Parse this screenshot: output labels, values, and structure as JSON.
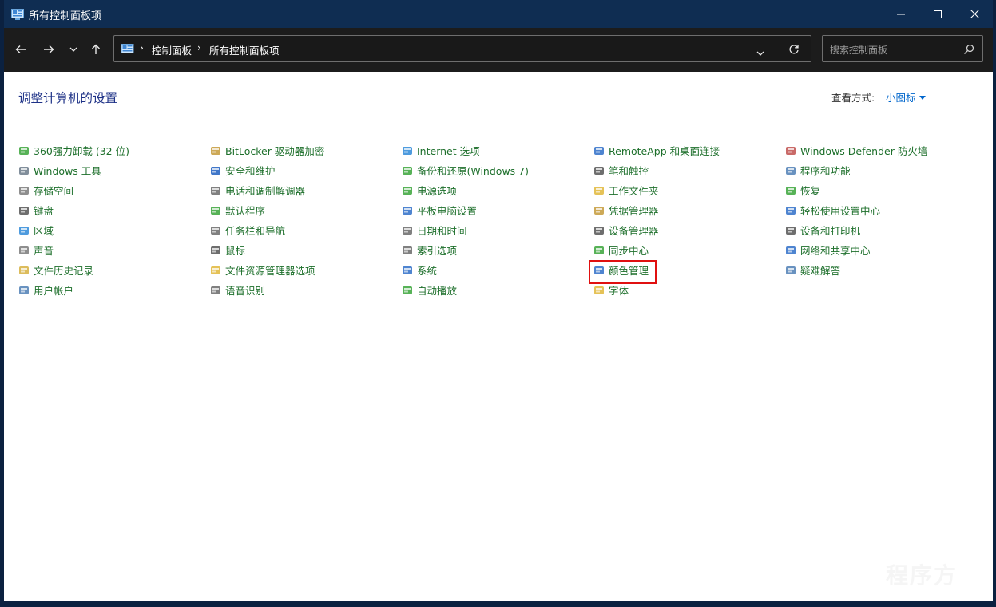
{
  "window": {
    "title": "所有控制面板项",
    "controls": [
      "minimize",
      "maximize",
      "close"
    ]
  },
  "nav": {
    "breadcrumb": [
      "控制面板",
      "所有控制面板项"
    ],
    "search_placeholder": "搜索控制面板"
  },
  "content": {
    "heading": "调整计算机的设置",
    "view_by_label": "查看方式:",
    "view_by_value": "小图标"
  },
  "columns": [
    [
      {
        "label": "360强力卸载 (32 位)",
        "icon": "uninstall-icon",
        "color": "#3aa53a"
      },
      {
        "label": "Windows 工具",
        "icon": "tools-icon",
        "color": "#6b7a8a"
      },
      {
        "label": "存储空间",
        "icon": "storage-icon",
        "color": "#7a7a7a"
      },
      {
        "label": "键盘",
        "icon": "keyboard-icon",
        "color": "#555555"
      },
      {
        "label": "区域",
        "icon": "globe-icon",
        "color": "#2f8ad8"
      },
      {
        "label": "声音",
        "icon": "speaker-icon",
        "color": "#7a7a7a"
      },
      {
        "label": "文件历史记录",
        "icon": "file-history-icon",
        "color": "#d6b040"
      },
      {
        "label": "用户帐户",
        "icon": "users-icon",
        "color": "#4f7fb5"
      }
    ],
    [
      {
        "label": "BitLocker 驱动器加密",
        "icon": "bitlocker-icon",
        "color": "#c49a3a"
      },
      {
        "label": "安全和维护",
        "icon": "flag-icon",
        "color": "#1f5fbf"
      },
      {
        "label": "电话和调制解调器",
        "icon": "phone-modem-icon",
        "color": "#6a6a6a"
      },
      {
        "label": "默认程序",
        "icon": "default-programs-icon",
        "color": "#3aa53a"
      },
      {
        "label": "任务栏和导航",
        "icon": "taskbar-icon",
        "color": "#6a6a6a"
      },
      {
        "label": "鼠标",
        "icon": "mouse-icon",
        "color": "#555555"
      },
      {
        "label": "文件资源管理器选项",
        "icon": "folder-options-icon",
        "color": "#e1b73a"
      },
      {
        "label": "语音识别",
        "icon": "microphone-icon",
        "color": "#6a6a6a"
      }
    ],
    [
      {
        "label": "Internet 选项",
        "icon": "internet-icon",
        "color": "#2f8ad8"
      },
      {
        "label": "备份和还原(Windows 7)",
        "icon": "backup-icon",
        "color": "#3aa53a"
      },
      {
        "label": "电源选项",
        "icon": "power-icon",
        "color": "#3aa53a"
      },
      {
        "label": "平板电脑设置",
        "icon": "tablet-icon",
        "color": "#2f6fc8"
      },
      {
        "label": "日期和时间",
        "icon": "clock-icon",
        "color": "#6a6a6a"
      },
      {
        "label": "索引选项",
        "icon": "indexing-icon",
        "color": "#6a6a6a"
      },
      {
        "label": "系统",
        "icon": "system-icon",
        "color": "#2f6fc8"
      },
      {
        "label": "自动播放",
        "icon": "autoplay-icon",
        "color": "#3aa53a"
      }
    ],
    [
      {
        "label": "RemoteApp 和桌面连接",
        "icon": "remoteapp-icon",
        "color": "#2f6fc8"
      },
      {
        "label": "笔和触控",
        "icon": "pen-icon",
        "color": "#555555"
      },
      {
        "label": "工作文件夹",
        "icon": "work-folders-icon",
        "color": "#e1b73a"
      },
      {
        "label": "凭据管理器",
        "icon": "credential-icon",
        "color": "#c49a3a"
      },
      {
        "label": "设备管理器",
        "icon": "device-manager-icon",
        "color": "#555555"
      },
      {
        "label": "同步中心",
        "icon": "sync-icon",
        "color": "#3aa53a"
      },
      {
        "label": "颜色管理",
        "icon": "color-management-icon",
        "color": "#2f6fc8"
      },
      {
        "label": "字体",
        "icon": "font-icon",
        "color": "#e1b73a"
      }
    ],
    [
      {
        "label": "Windows Defender 防火墙",
        "icon": "firewall-icon",
        "color": "#c0504d"
      },
      {
        "label": "程序和功能",
        "icon": "programs-icon",
        "color": "#4f7fb5"
      },
      {
        "label": "恢复",
        "icon": "recovery-icon",
        "color": "#3aa53a"
      },
      {
        "label": "轻松使用设置中心",
        "icon": "ease-of-access-icon",
        "color": "#2f6fc8"
      },
      {
        "label": "设备和打印机",
        "icon": "printer-icon",
        "color": "#555555"
      },
      {
        "label": "网络和共享中心",
        "icon": "network-icon",
        "color": "#2f6fc8"
      },
      {
        "label": "疑难解答",
        "icon": "troubleshoot-icon",
        "color": "#4f7fb5"
      }
    ]
  ],
  "highlighted_item": "颜色管理",
  "watermark": "程序方",
  "colors": {
    "titlebar": "#0f2d52",
    "navbar": "#1c1c1c",
    "heading": "#1e3287",
    "link": "#1d6f2b",
    "accent_link": "#0066cc",
    "highlight_border": "#e01010"
  }
}
